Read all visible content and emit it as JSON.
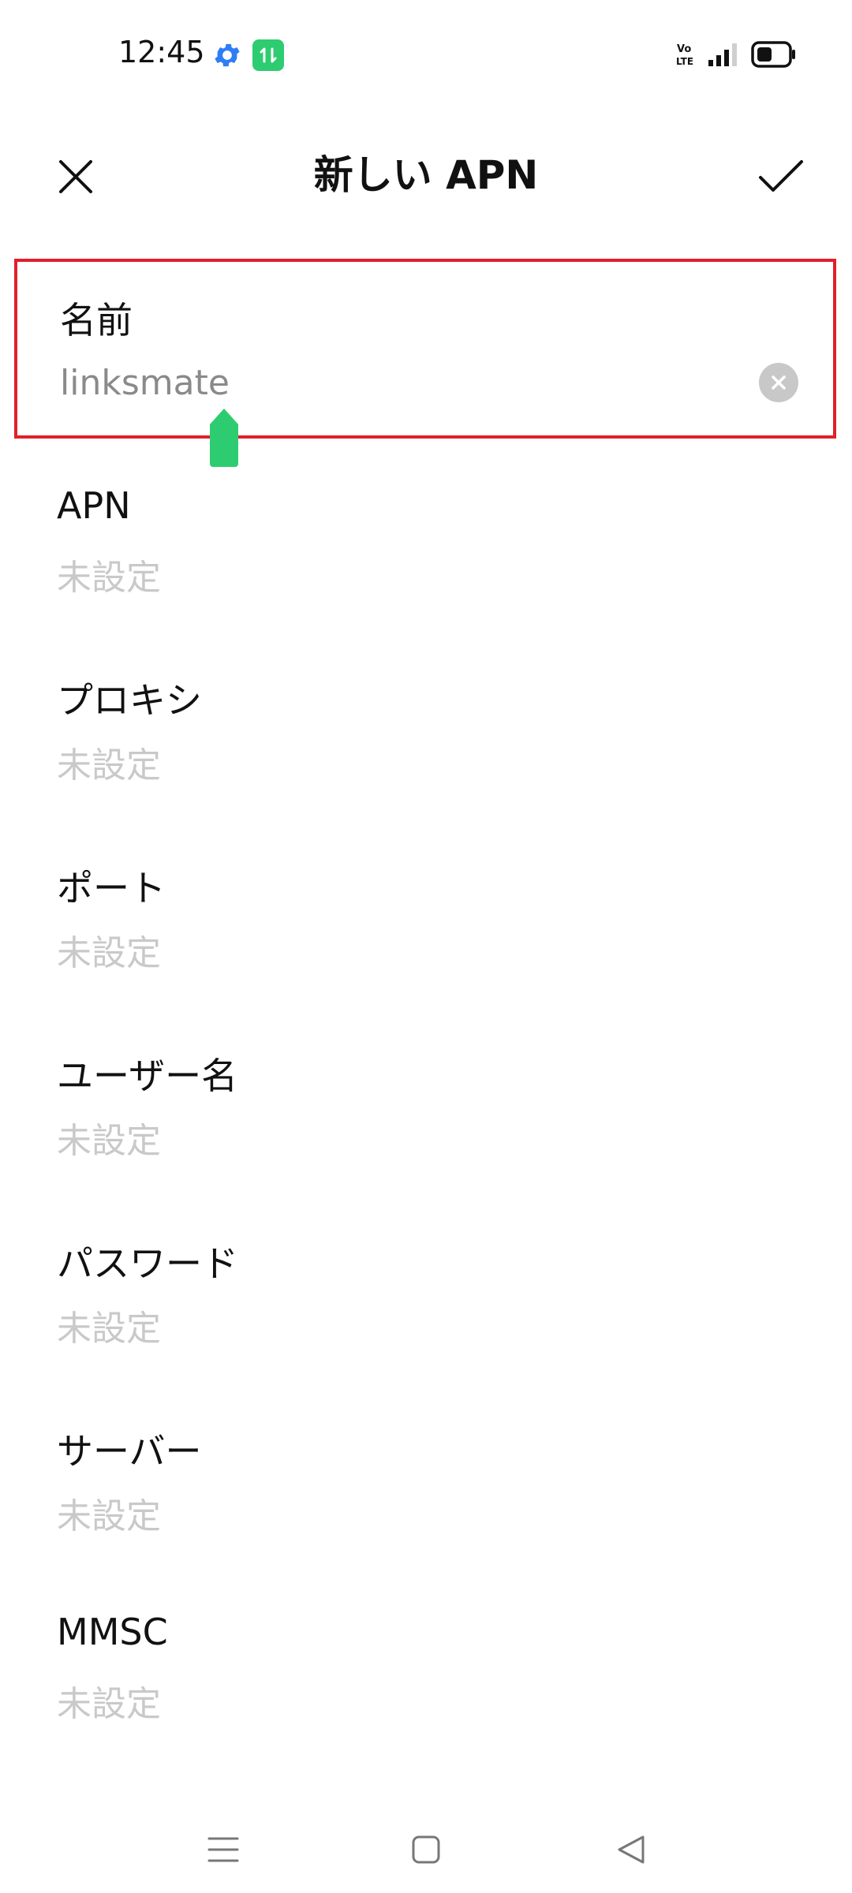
{
  "status": {
    "time": "12:45",
    "icons": [
      "gear-icon",
      "data-transfer-icon",
      "volte-icon",
      "signal-icon",
      "battery-icon"
    ],
    "data_glyph": "↑↓"
  },
  "header": {
    "title": "新しい APN",
    "close_icon": "close-icon",
    "confirm_icon": "check-icon"
  },
  "fields": {
    "name": {
      "label": "名前",
      "value": "linksmate"
    },
    "apn": {
      "label": "APN",
      "value": "未設定"
    },
    "proxy": {
      "label": "プロキシ",
      "value": "未設定"
    },
    "port": {
      "label": "ポート",
      "value": "未設定"
    },
    "username": {
      "label": "ユーザー名",
      "value": "未設定"
    },
    "password": {
      "label": "パスワード",
      "value": "未設定"
    },
    "server": {
      "label": "サーバー",
      "value": "未設定"
    },
    "mmsc": {
      "label": "MMSC",
      "value": "未設定"
    }
  },
  "nav": {
    "icons": [
      "menu-icon",
      "home-icon",
      "back-icon"
    ]
  },
  "colors": {
    "accent": "#2ecc71",
    "highlight": "#e0202a",
    "placeholder": "#c9c9c9"
  }
}
